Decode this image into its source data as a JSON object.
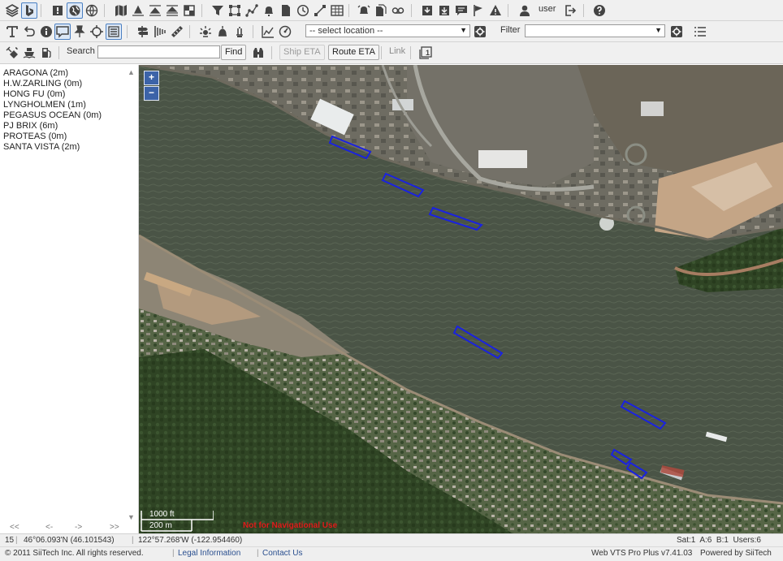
{
  "toolbar_top": {
    "user_label": "user",
    "icons": [
      "layers-icon",
      "bing-icon",
      "alert-icon",
      "globe-selected-icon",
      "globe-icon",
      "map-icon",
      "chart-icon",
      "chart2-icon",
      "chart3-icon",
      "contrast-icon",
      "filter-icon",
      "shape-icon",
      "route-icon",
      "bell-icon",
      "document-icon",
      "clock-icon",
      "line-icon",
      "grid-icon",
      "alarm-icon",
      "doc2-icon",
      "voicemail-icon",
      "download-icon",
      "download2-icon",
      "message-icon",
      "flag-icon",
      "warning-icon",
      "user-icon",
      "logout-icon",
      "help-icon"
    ]
  },
  "toolbar_mid": {
    "location_select": "-- select location --",
    "filter_label": "Filter",
    "filter_select": ""
  },
  "toolbar_low": {
    "search_label": "Search",
    "search_value": "",
    "find_button": "Find",
    "ship_eta_button": "Ship ETA",
    "route_eta_button": "Route ETA",
    "link_label": "Link",
    "frame_count": "1"
  },
  "vessels": [
    "ARAGONA (2m)",
    "H.W.ZARLING (0m)",
    "HONG FU (0m)",
    "LYNGHOLMEN (1m)",
    "PEGASUS OCEAN (0m)",
    "PJ BRIX (6m)",
    "PROTEAS (0m)",
    "SANTA VISTA (2m)"
  ],
  "pager": {
    "first": "<<",
    "prev": "<-",
    "next": "->",
    "last": ">>"
  },
  "map": {
    "zoom_in": "+",
    "zoom_out": "−",
    "scale_feet": "1000 ft",
    "scale_meters": "200 m",
    "watermark": "Not for Navigational Use",
    "vessel_color": "#1a22e0"
  },
  "status": {
    "zoom_level": "15",
    "latitude": "46°06.093'N (46.101543)",
    "longitude": "122°57.268'W (-122.954460)",
    "counts": "Sat:1  A:6  B:1  Users:6"
  },
  "footer": {
    "copyright": "© 2011 SiiTech Inc. All rights reserved.",
    "legal": "Legal Information",
    "contact": "Contact Us",
    "version": "Web VTS Pro Plus v7.41.03",
    "powered": "Powered by SiiTech"
  }
}
